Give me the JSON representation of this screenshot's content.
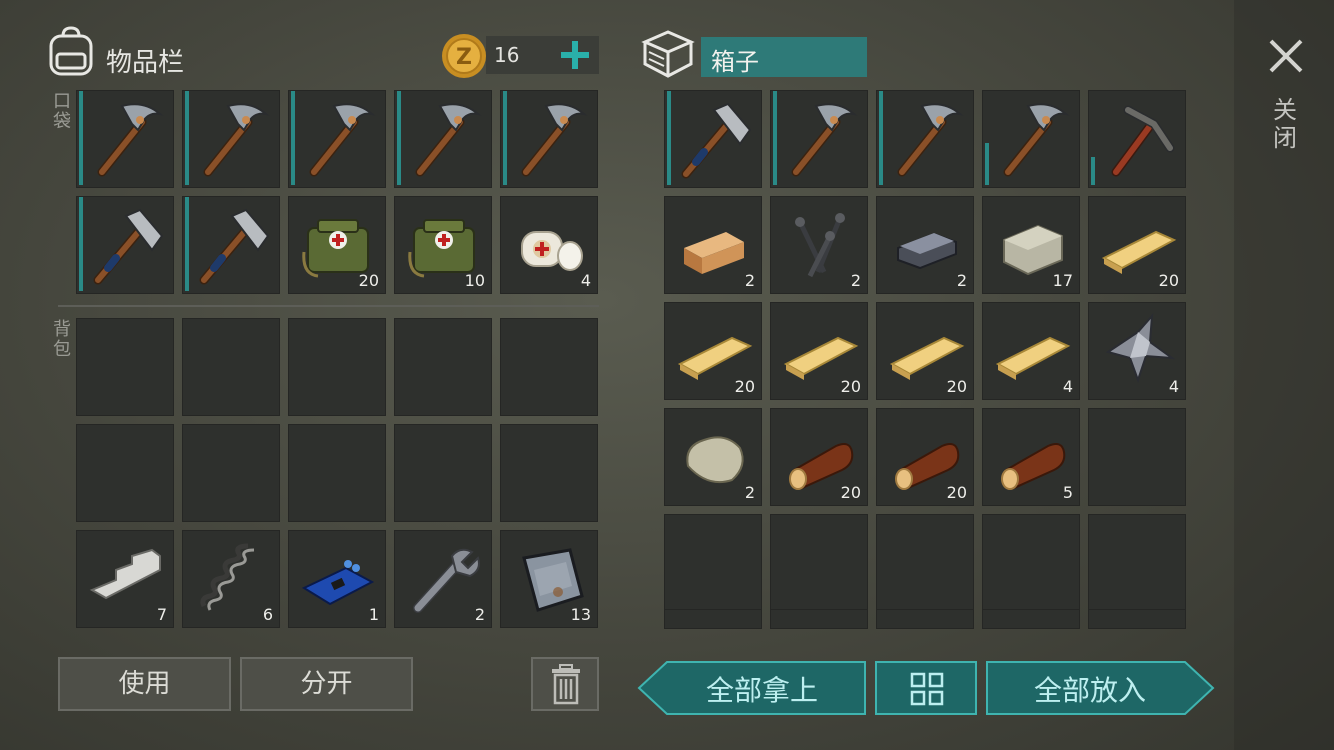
{
  "inventory": {
    "title": "物品栏",
    "coins": "16",
    "pocket_label": "口袋",
    "backpack_label": "背包",
    "pocket": [
      {
        "icon": "pickaxe",
        "count": "",
        "durability": 1.0
      },
      {
        "icon": "pickaxe",
        "count": "",
        "durability": 1.0
      },
      {
        "icon": "pickaxe",
        "count": "",
        "durability": 1.0
      },
      {
        "icon": "pickaxe",
        "count": "",
        "durability": 1.0
      },
      {
        "icon": "pickaxe",
        "count": "",
        "durability": 1.0
      },
      {
        "icon": "axe",
        "count": "",
        "durability": 1.0
      },
      {
        "icon": "axe",
        "count": "",
        "durability": 1.0
      },
      {
        "icon": "medkit",
        "count": "20",
        "durability": null
      },
      {
        "icon": "medkit",
        "count": "10",
        "durability": null
      },
      {
        "icon": "bandage",
        "count": "4",
        "durability": null
      }
    ],
    "backpack": [
      {
        "icon": "",
        "count": ""
      },
      {
        "icon": "",
        "count": ""
      },
      {
        "icon": "",
        "count": ""
      },
      {
        "icon": "",
        "count": ""
      },
      {
        "icon": "",
        "count": ""
      },
      {
        "icon": "",
        "count": ""
      },
      {
        "icon": "",
        "count": ""
      },
      {
        "icon": "",
        "count": ""
      },
      {
        "icon": "",
        "count": ""
      },
      {
        "icon": "",
        "count": ""
      },
      {
        "icon": "aluminum-ingot",
        "count": "7"
      },
      {
        "icon": "spring",
        "count": "6"
      },
      {
        "icon": "circuit-board",
        "count": "1"
      },
      {
        "icon": "wrench",
        "count": "2"
      },
      {
        "icon": "metal-plate",
        "count": "13"
      }
    ],
    "use_label": "使用",
    "split_label": "分开"
  },
  "box": {
    "title": "箱子",
    "slots": [
      {
        "icon": "axe",
        "count": "",
        "durability": 1.0
      },
      {
        "icon": "pickaxe",
        "count": "",
        "durability": 1.0
      },
      {
        "icon": "pickaxe",
        "count": "",
        "durability": 1.0
      },
      {
        "icon": "pickaxe",
        "count": "",
        "durability": 0.45
      },
      {
        "icon": "iron-pickaxe",
        "count": "",
        "durability": 0.3
      },
      {
        "icon": "plank-block",
        "count": "2"
      },
      {
        "icon": "nails",
        "count": "2"
      },
      {
        "icon": "iron-ingot",
        "count": "2"
      },
      {
        "icon": "stone-block",
        "count": "17"
      },
      {
        "icon": "plank",
        "count": "20"
      },
      {
        "icon": "plank",
        "count": "20"
      },
      {
        "icon": "plank",
        "count": "20"
      },
      {
        "icon": "plank",
        "count": "20"
      },
      {
        "icon": "plank",
        "count": "4"
      },
      {
        "icon": "scrap-metal",
        "count": "4"
      },
      {
        "icon": "stone",
        "count": "2"
      },
      {
        "icon": "log",
        "count": "20"
      },
      {
        "icon": "log",
        "count": "20"
      },
      {
        "icon": "log",
        "count": "5"
      },
      {
        "icon": "",
        "count": ""
      },
      {
        "icon": "",
        "count": ""
      },
      {
        "icon": "",
        "count": ""
      },
      {
        "icon": "",
        "count": ""
      },
      {
        "icon": "",
        "count": ""
      },
      {
        "icon": "",
        "count": ""
      }
    ],
    "take_all_label": "全部拿上",
    "put_all_label": "全部放入"
  },
  "close_label": "关闭",
  "colors": {
    "accent": "#2a8a87",
    "button_fill": "#1e6766"
  }
}
